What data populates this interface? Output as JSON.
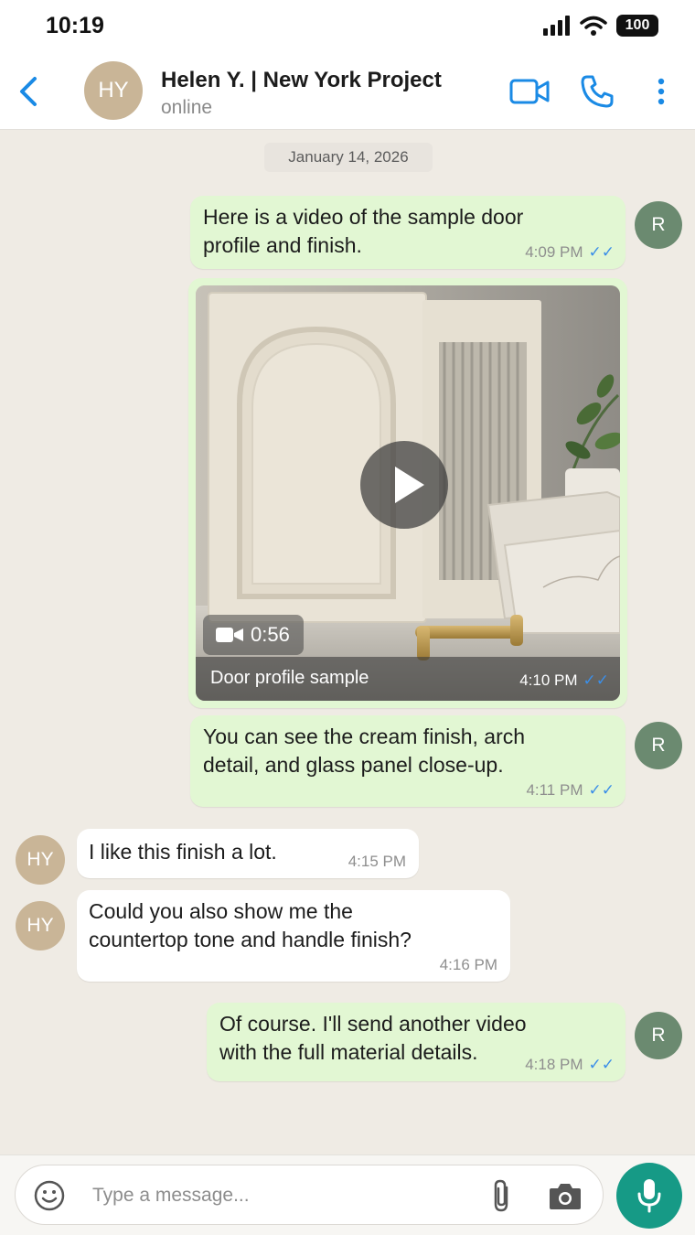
{
  "status_bar": {
    "time": "10:19",
    "battery": "100"
  },
  "header": {
    "avatar_initials": "HY",
    "name": "Helen Y. | New York Project",
    "status": "online"
  },
  "chat": {
    "date": "January 14, 2026",
    "messages": [
      {
        "sender": "R",
        "text_line1": "Here is a video of the sample door",
        "text_line2": "profile and finish.",
        "time": "4:09 PM",
        "ticks": "✓✓"
      },
      {
        "sender": "R",
        "type": "video",
        "duration": "0:56",
        "caption": "Door profile sample",
        "time": "4:10 PM",
        "ticks": "✓✓"
      },
      {
        "sender": "R",
        "text_line1": "You can see the cream finish, arch",
        "text_line2": "detail, and glass panel close-up.",
        "time": "4:11 PM",
        "ticks": "✓✓"
      },
      {
        "sender": "HY",
        "text_line1": "I like this finish a lot.",
        "time": "4:15 PM"
      },
      {
        "sender": "HY",
        "text_line1": "Could you also show me the",
        "text_line2": "countertop tone and handle finish?",
        "time": "4:16 PM"
      },
      {
        "sender": "R",
        "text_line1": "Of course. I'll send another video",
        "text_line2": "with the full material details.",
        "time": "4:18 PM",
        "ticks": "✓✓"
      }
    ]
  },
  "input": {
    "placeholder": "Type a message..."
  },
  "colors": {
    "accent": "#1a8ae5",
    "outgoing_bubble": "#e2f7d3",
    "mic_button": "#169a86",
    "avatar_r": "#6b8a70",
    "avatar_hy": "#c9b597"
  }
}
